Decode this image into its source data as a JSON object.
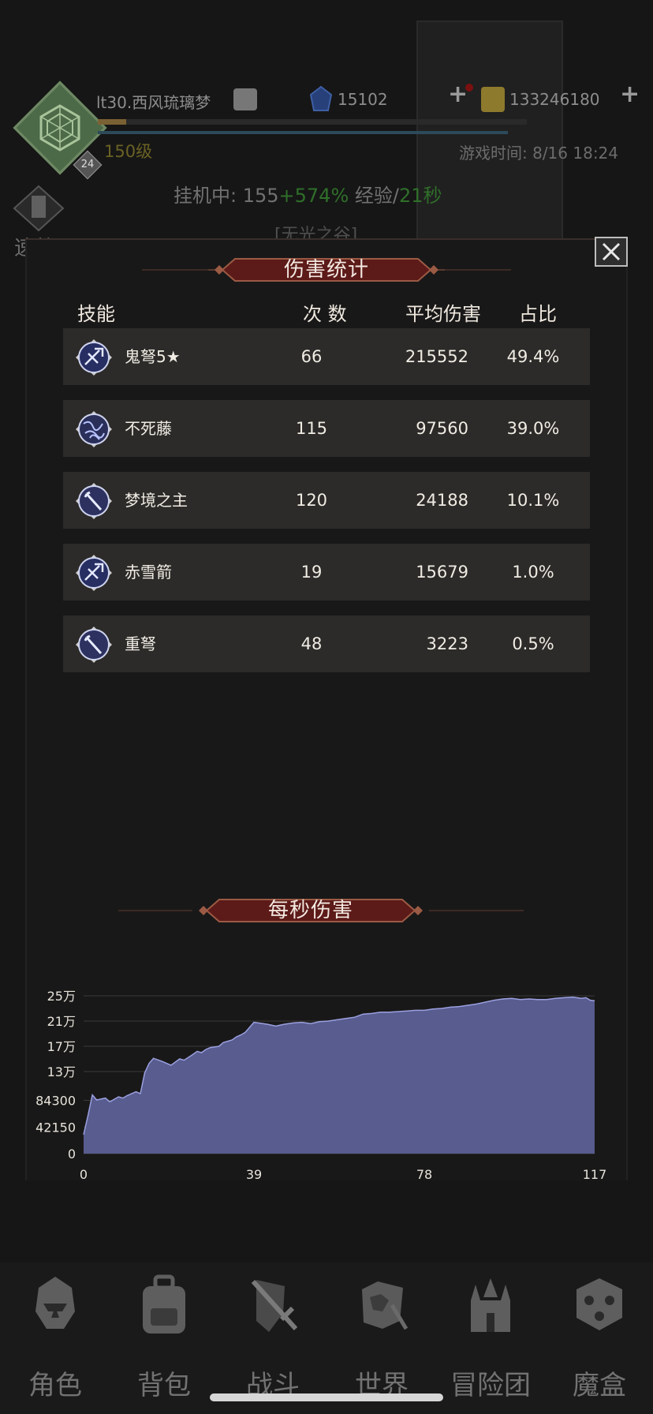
{
  "player": {
    "name": "lt30.西风琉璃梦",
    "badge_level": "24",
    "level_text": "150级",
    "gems": "15102",
    "gold": "133246180",
    "game_time": "游戏时间: 8/16 18:24",
    "idle_prefix": "挂机中: 155",
    "idle_bonus": "+574%",
    "idle_exp_label": " 经验/",
    "idle_exp_time": "21秒",
    "speed_label": "速战",
    "zone": "[无光之谷]"
  },
  "modal": {
    "title": "伤害统计",
    "headers": {
      "skill": "技能",
      "count": "次 数",
      "avg": "平均伤害",
      "pct": "占比"
    },
    "rows": [
      {
        "name": "鬼弩5★",
        "count": "66",
        "avg": "215552",
        "pct": "49.4%",
        "icon": "ghost-crossbow-icon"
      },
      {
        "name": "不死藤",
        "count": "115",
        "avg": "97560",
        "pct": "39.0%",
        "icon": "undying-vine-icon"
      },
      {
        "name": "梦境之主",
        "count": "120",
        "avg": "24188",
        "pct": "10.1%",
        "icon": "dream-lord-icon"
      },
      {
        "name": "赤雪箭",
        "count": "19",
        "avg": "15679",
        "pct": "1.0%",
        "icon": "red-snow-arrow-icon"
      },
      {
        "name": "重弩",
        "count": "48",
        "avg": "3223",
        "pct": "0.5%",
        "icon": "heavy-crossbow-icon"
      }
    ],
    "dps_title": "每秒伤害"
  },
  "chart_data": {
    "type": "area",
    "title": "每秒伤害",
    "xlabel": "",
    "ylabel": "",
    "x_ticks": [
      "0",
      "39",
      "78",
      "117"
    ],
    "y_ticks": [
      "0",
      "42150",
      "84300",
      "13万",
      "17万",
      "21万",
      "25万"
    ],
    "y_tick_values": [
      0,
      42150,
      84300,
      130000,
      170000,
      210000,
      250000
    ],
    "xlim": [
      0,
      117
    ],
    "ylim": [
      0,
      250000
    ],
    "grid": true,
    "fill_color": "#585c8e",
    "line_color": "#9aa0e0",
    "x": [
      0,
      1,
      2,
      3,
      5,
      6,
      8,
      9,
      10,
      12,
      13,
      14,
      15,
      16,
      18,
      19,
      20,
      22,
      23,
      25,
      26,
      27,
      28,
      29,
      31,
      32,
      33,
      34,
      35,
      36,
      37,
      38,
      39,
      40,
      42,
      44,
      46,
      48,
      50,
      52,
      54,
      56,
      58,
      60,
      62,
      64,
      66,
      68,
      70,
      72,
      74,
      76,
      78,
      80,
      82,
      84,
      86,
      88,
      90,
      92,
      94,
      96,
      98,
      100,
      102,
      104,
      106,
      108,
      110,
      112,
      114,
      115,
      116,
      117
    ],
    "y": [
      30000,
      60000,
      93000,
      85000,
      88000,
      82000,
      90000,
      88000,
      92000,
      98000,
      95000,
      128000,
      143000,
      151000,
      146000,
      143000,
      140000,
      150000,
      148000,
      157000,
      162000,
      160000,
      165000,
      168000,
      170000,
      176000,
      178000,
      180000,
      185000,
      188000,
      192000,
      200000,
      208000,
      207000,
      205000,
      202000,
      205000,
      207000,
      208000,
      206000,
      209000,
      210000,
      212000,
      214000,
      216000,
      221000,
      222000,
      224000,
      224000,
      225000,
      226000,
      227000,
      227000,
      229000,
      230000,
      232000,
      233000,
      235000,
      237000,
      240000,
      243000,
      245000,
      246000,
      244000,
      245000,
      244000,
      244000,
      246000,
      247000,
      248000,
      246000,
      247000,
      243000,
      242000
    ]
  },
  "nav": [
    {
      "label": "角色",
      "icon": "character-helmet-icon"
    },
    {
      "label": "背包",
      "icon": "backpack-icon"
    },
    {
      "label": "战斗",
      "icon": "sword-shield-icon"
    },
    {
      "label": "世界",
      "icon": "world-map-icon"
    },
    {
      "label": "冒险团",
      "icon": "guild-castle-icon"
    },
    {
      "label": "魔盒",
      "icon": "magic-box-icon"
    }
  ]
}
